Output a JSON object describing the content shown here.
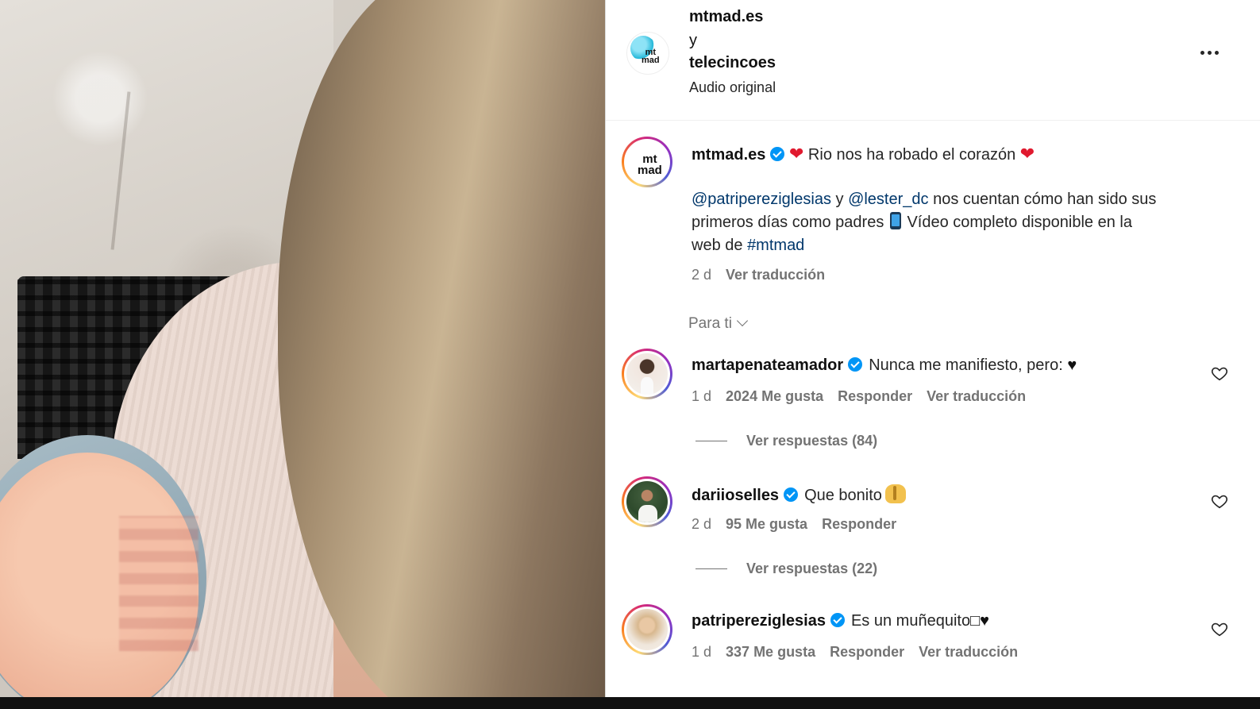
{
  "header": {
    "user1": "mtmad.es",
    "connector": "y",
    "user2": "telecincoes",
    "audio": "Audio original",
    "avatar_logo": "mt\nmad"
  },
  "caption": {
    "username": "mtmad.es",
    "heart_left": "❤",
    "text1": " Rio nos ha robado el corazón ",
    "heart_right": "❤",
    "mention1": "@patripereziglesias",
    "connector": " y ",
    "mention2": "@lester_dc",
    "line1_rest": " nos cuentan cómo han sido sus",
    "line2": "primeros días como padres ",
    "line2_rest": " Vídeo completo disponible en la",
    "line3": "web de ",
    "hashtag": "#mtmad",
    "time": "2 d",
    "translate": "Ver traducción",
    "avatar_logo": "mt\nmad"
  },
  "sort_label": "Para ti",
  "comments": [
    {
      "username": "martapenateamador",
      "text": "Nunca me manifiesto, pero:",
      "suffix": "♥",
      "time": "1 d",
      "likes": "2024 Me gusta",
      "reply": "Responder",
      "translate": "Ver traducción",
      "replies": "Ver respuestas (84)"
    },
    {
      "username": "dariioselles",
      "text": "Que bonito",
      "time": "2 d",
      "likes": "95 Me gusta",
      "reply": "Responder",
      "replies": "Ver respuestas (22)"
    },
    {
      "username": "patripereziglesias",
      "text": "Es un muñequito",
      "suffix": "□♥",
      "time": "1 d",
      "likes": "337 Me gusta",
      "reply": "Responder",
      "translate": "Ver traducción"
    }
  ],
  "colors": {
    "link": "#00376b",
    "verified": "#0095f6",
    "muted": "#737373",
    "heart": "#e0192e"
  }
}
